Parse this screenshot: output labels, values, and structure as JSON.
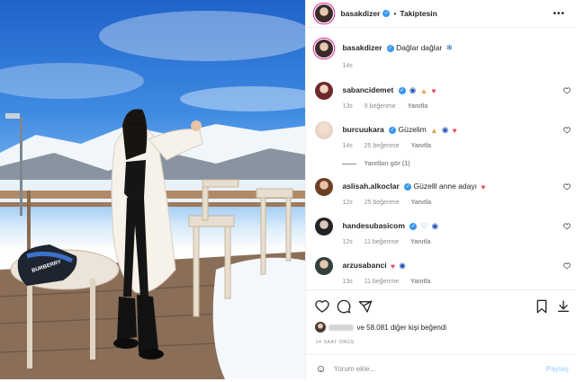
{
  "header": {
    "username": "basakdizer",
    "separator": "•",
    "follow_status": "Takiptesin",
    "more": "•••"
  },
  "caption": {
    "username": "basakdizer",
    "text": "Dağlar dağlar",
    "time": "14s"
  },
  "comments": [
    {
      "username": "sabancidemet",
      "text": "",
      "time": "13s",
      "likes": "9 beğenme",
      "reply": "Yanıtla",
      "verified": true
    },
    {
      "username": "burcuukara",
      "text": "Güzelim",
      "time": "14s",
      "likes": "25 beğenme",
      "reply": "Yanıtla",
      "verified": true,
      "view_replies": "Yanıtları gör (1)"
    },
    {
      "username": "aslisah.alkoclar",
      "text": "Güzelll anne adayı",
      "time": "12s",
      "likes": "25 beğenme",
      "reply": "Yanıtla",
      "verified": true
    },
    {
      "username": "handesubasicom",
      "text": "",
      "time": "12s",
      "likes": "11 beğenme",
      "reply": "Yanıtla",
      "verified": true
    },
    {
      "username": "arzusabanci",
      "text": "",
      "time": "13s",
      "likes": "11 beğenme",
      "reply": "Yanıtla",
      "verified": false
    }
  ],
  "likes": {
    "text": "ve 58.081 diğer kişi beğendi"
  },
  "posted_ago": "14 SAAT ÖNCE",
  "add_comment": {
    "placeholder": "Yorum ekle...",
    "post_label": "Paylaş"
  },
  "photo": {
    "bag_brand": "BURBERRY"
  },
  "colors": {
    "verified": "#3897f0",
    "heart": "#ed4956",
    "muted": "#8e8e8e",
    "post_button": "#b3dbff"
  }
}
